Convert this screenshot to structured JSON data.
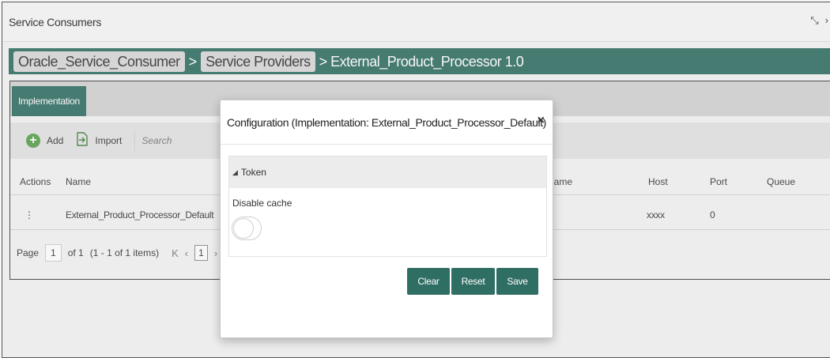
{
  "window": {
    "title": "Service Consumers",
    "icons": [
      "minimize-icon",
      "close-icon"
    ]
  },
  "breadcrumb": {
    "items": [
      "Oracle_Service_Consumer",
      "Service Providers"
    ],
    "separator": ">",
    "current": "> External_Product_Processor 1.0"
  },
  "tabs": {
    "active": "Implementation"
  },
  "toolbar": {
    "add_label": "Add",
    "import_label": "Import",
    "search_placeholder": "Search"
  },
  "table": {
    "columns": [
      "Actions",
      "Name",
      "Name",
      "Host",
      "Port",
      "Queue"
    ],
    "rows": [
      {
        "actions": "⋮",
        "name": "External_Product_Processor_Default",
        "host": "xxxx",
        "port": "0"
      }
    ]
  },
  "pager": {
    "page_label": "Page",
    "page_value": "1",
    "of_text": "of 1",
    "items_text": "(1 - 1 of 1 items)",
    "first": "K",
    "prev": "‹",
    "current": "1",
    "next": "›"
  },
  "modal": {
    "title": "Configuration (Implementation: External_Product_Processor_Default)",
    "close": "×",
    "section_title": "Token",
    "field_label": "Disable cache",
    "toggle_state": "off",
    "buttons": {
      "clear": "Clear",
      "reset": "Reset",
      "save": "Save"
    }
  },
  "colors": {
    "accent": "#2f6e63",
    "add_icon": "#57a04a"
  }
}
